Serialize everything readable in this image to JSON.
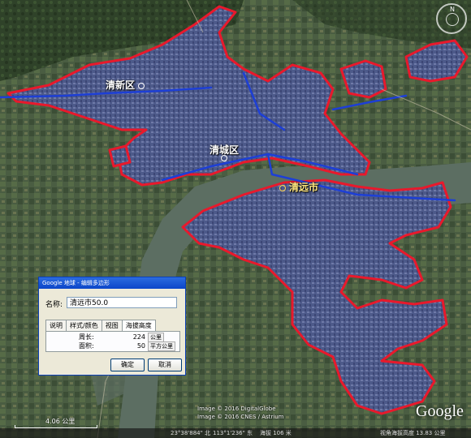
{
  "map": {
    "places": [
      {
        "name": "清新区",
        "style": "white"
      },
      {
        "name": "清城区",
        "style": "white"
      },
      {
        "name": "清远市",
        "style": "yellow"
      }
    ],
    "compass_label": "N",
    "scale_label": "4.06 公里",
    "credits": [
      "Image © 2016 DigitalGlobe",
      "Image © 2016 CNES / Astrium"
    ],
    "logo": "Google",
    "colors": {
      "outline_red": "#e8192c",
      "road_blue": "#1d3fd6",
      "urban_fill": "#4b5a8c",
      "river": "#5c6e62"
    }
  },
  "status_bar": {
    "coords_lat": "23°38'884\" 北",
    "coords_lng": "113°1'236\" 东",
    "elevation": "海拔 106 米",
    "eye_alt": "视角海拔高度 13.83 公里"
  },
  "dialog": {
    "title": "Google 地球 - 编辑多边形",
    "name_label": "名称:",
    "name_value": "清远市50.0",
    "tabs": [
      "说明",
      "样式/颜色",
      "视图",
      "海拔高度"
    ],
    "perimeter_label": "周长:",
    "perimeter_value": "224",
    "perimeter_unit": "公里",
    "area_label": "面积:",
    "area_value": "50",
    "area_unit": "平方公里",
    "ok_label": "确定",
    "cancel_label": "取消"
  }
}
